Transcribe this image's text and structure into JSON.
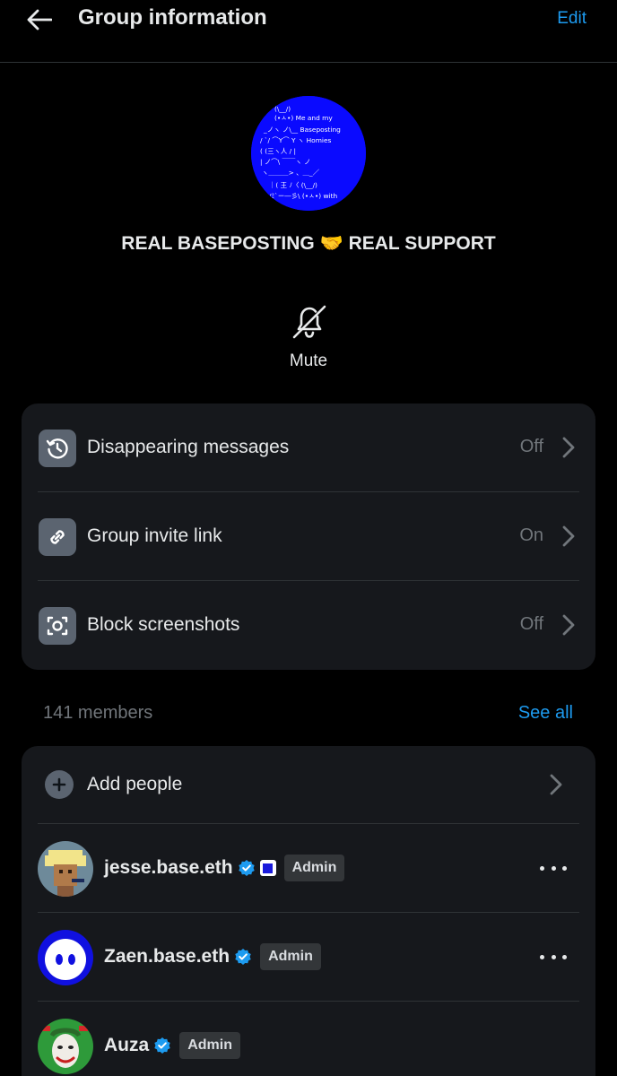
{
  "header": {
    "back_icon": "arrow-left-icon",
    "title": "Group information",
    "edit_label": "Edit"
  },
  "group": {
    "avatar_text": [
      "(\\__/)",
      "(•ㅅ•) Me and my",
      "_ノヽ ノ\\__ Baseposting",
      "/ `/ ⌒Y⌒ Y ヽ Homies",
      "( (三ヽ人 / |",
      "| ノ⌒\\ ￣￣ヽ ノ",
      "ヽ＿＿＿> 、＿_／",
      "｜( 王 ﾉ〈 (\\__/)",
      "/ﾐ`ー―彡\\ (•ㅅ•) with"
    ],
    "name": "REAL BASEPOSTING 🤝 REAL SUPPORT",
    "avatar_color": "#0a0aff"
  },
  "mute": {
    "icon": "bell-off-icon",
    "label": "Mute"
  },
  "settings": [
    {
      "icon": "timer-icon",
      "label": "Disappearing messages",
      "value": "Off"
    },
    {
      "icon": "link-icon",
      "label": "Group invite link",
      "value": "On"
    },
    {
      "icon": "screenshot-icon",
      "label": "Block screenshots",
      "value": "Off"
    }
  ],
  "members_section": {
    "count_label": "141 members",
    "see_all_label": "See all",
    "add_label": "Add people",
    "members": [
      {
        "name": "jesse.base.eth",
        "badge": "Admin",
        "verified": true,
        "affiliate": true
      },
      {
        "name": "Zaen.base.eth",
        "badge": "Admin",
        "verified": true,
        "affiliate": false
      },
      {
        "name": "Auza",
        "badge": "Admin",
        "verified": true,
        "affiliate": false
      }
    ]
  },
  "colors": {
    "accent": "#1d9bf0",
    "background": "#000000",
    "card": "#16181c",
    "muted_text": "#71767b"
  }
}
